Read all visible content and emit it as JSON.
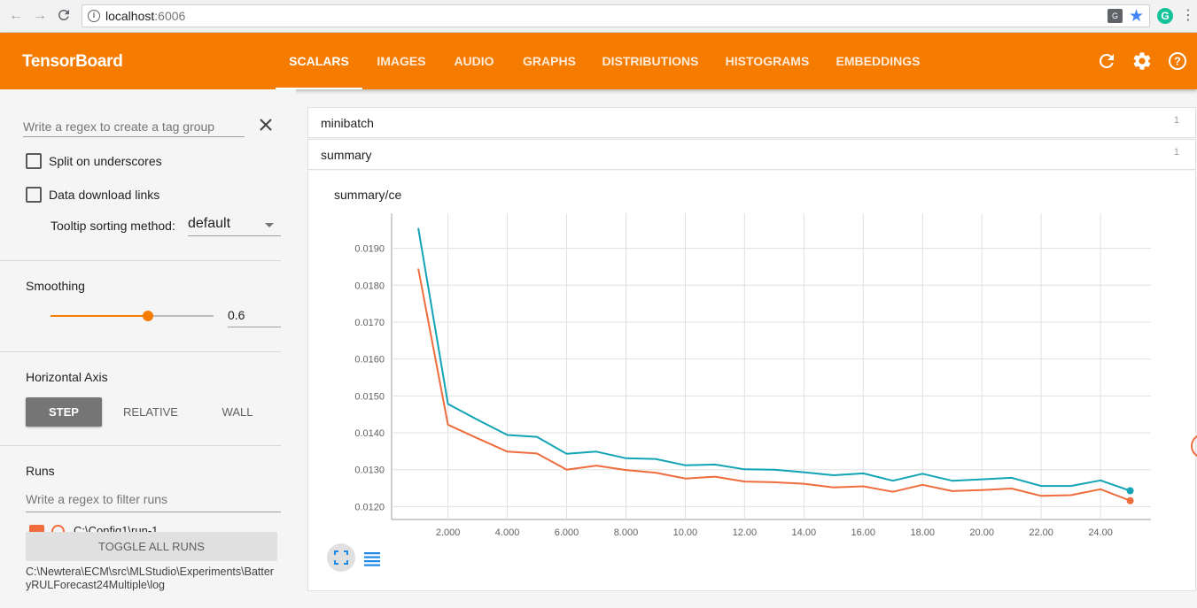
{
  "browser": {
    "url_host": "localhost",
    "url_port": ":6006",
    "translate_icon": "translate-icon",
    "bookmark_icon": "star-icon",
    "extension_letter": "G"
  },
  "header": {
    "title": "TensorBoard",
    "tabs": [
      {
        "label": "SCALARS",
        "active": true
      },
      {
        "label": "IMAGES"
      },
      {
        "label": "AUDIO"
      },
      {
        "label": "GRAPHS"
      },
      {
        "label": "DISTRIBUTIONS"
      },
      {
        "label": "HISTOGRAMS"
      },
      {
        "label": "EMBEDDINGS"
      }
    ],
    "icons": [
      "reload-icon",
      "gear-icon",
      "help-icon"
    ],
    "color": "#f57c00"
  },
  "sidebar": {
    "tag_regex_placeholder": "Write a regex to create a tag group",
    "split_label": "Split on underscores",
    "download_label": "Data download links",
    "tooltip_label": "Tooltip sorting method:",
    "tooltip_value": "default",
    "smoothing_title": "Smoothing",
    "smoothing_value": "0.6",
    "smoothing_fraction": 0.6,
    "axis_title": "Horizontal Axis",
    "axis_options": [
      "STEP",
      "RELATIVE",
      "WALL"
    ],
    "axis_selected": "STEP",
    "runs_title": "Runs",
    "runs_placeholder": "Write a regex to filter runs",
    "run_name": "C:\\Config1\\run-1",
    "toggle_label": "TOGGLE ALL RUNS",
    "log_path": "C:\\Newtera\\ECM\\src\\MLStudio\\Experiments\\BatteryRULForecast24Multiple\\log"
  },
  "main": {
    "categories": [
      {
        "name": "minibatch",
        "count": "1"
      },
      {
        "name": "summary",
        "count": "1"
      }
    ],
    "card_title": "summary/ce"
  },
  "chart_data": {
    "type": "line",
    "title": "summary/ce",
    "x_ticks": [
      "2.000",
      "4.000",
      "6.000",
      "8.000",
      "10.00",
      "12.00",
      "14.00",
      "16.00",
      "18.00",
      "20.00",
      "22.00",
      "24.00"
    ],
    "y_ticks": [
      "0.0120",
      "0.0130",
      "0.0140",
      "0.0150",
      "0.0160",
      "0.0170",
      "0.0180",
      "0.0190"
    ],
    "xlim": [
      0.1,
      25.7
    ],
    "ylim": [
      0.01165,
      0.01995
    ],
    "grid": true,
    "series": [
      {
        "color": "#12a4b4",
        "x": [
          1,
          2,
          3,
          4,
          5,
          6,
          7,
          8,
          9,
          10,
          11,
          12,
          13,
          14,
          15,
          16,
          17,
          18,
          19,
          20,
          21,
          22,
          23,
          24,
          25
        ],
        "y": [
          0.01955,
          0.01478,
          0.01435,
          0.01394,
          0.01389,
          0.01343,
          0.01349,
          0.01331,
          0.01329,
          0.01312,
          0.01314,
          0.01301,
          0.013,
          0.01293,
          0.01285,
          0.0129,
          0.0127,
          0.01289,
          0.0127,
          0.01274,
          0.01278,
          0.01256,
          0.01256,
          0.01271,
          0.01243
        ]
      },
      {
        "color": "#ef6c3c",
        "x": [
          1,
          2,
          3,
          4,
          5,
          6,
          7,
          8,
          9,
          10,
          11,
          12,
          13,
          14,
          15,
          16,
          17,
          18,
          19,
          20,
          21,
          22,
          23,
          24,
          25
        ],
        "y": [
          0.01845,
          0.01422,
          0.01385,
          0.01349,
          0.01344,
          0.013,
          0.01311,
          0.01299,
          0.01292,
          0.01276,
          0.01281,
          0.01268,
          0.01266,
          0.01262,
          0.01252,
          0.01255,
          0.0124,
          0.01259,
          0.01242,
          0.01245,
          0.01249,
          0.01229,
          0.01231,
          0.01247,
          0.01216
        ]
      }
    ]
  }
}
